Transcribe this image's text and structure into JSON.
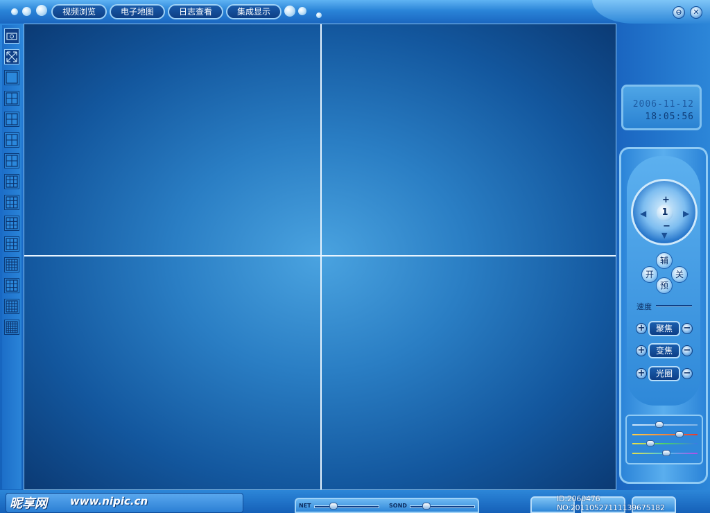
{
  "tabs": [
    {
      "label": "视频浏览"
    },
    {
      "label": "电子地图"
    },
    {
      "label": "日志查看"
    },
    {
      "label": "集成显示"
    }
  ],
  "window_buttons": {
    "minimize": "⊖",
    "close": "✕"
  },
  "clock": {
    "date": "2006-11-12",
    "time": "18:05:56"
  },
  "ptz": {
    "channel": "1",
    "zoom_in": "+",
    "zoom_out": "−",
    "aux_buttons": [
      {
        "label": "辅"
      },
      {
        "label": "开"
      },
      {
        "label": "关"
      },
      {
        "label": "预"
      }
    ],
    "speed_label": "速度",
    "controls": [
      {
        "label": "聚焦",
        "plus": "+",
        "minus": "−"
      },
      {
        "label": "变焦",
        "plus": "+",
        "minus": "−"
      },
      {
        "label": "光圈",
        "plus": "+",
        "minus": "−"
      }
    ]
  },
  "color_sliders": [
    {
      "level": 0.42
    },
    {
      "level": 0.72
    },
    {
      "level": 0.28
    },
    {
      "level": 0.52
    }
  ],
  "bottom": {
    "brand_cn": "昵享网",
    "brand_url": "www.nipic.cn",
    "net_label": "NET",
    "sond_label": "SOND",
    "net_level": 0.3,
    "sond_level": 0.25,
    "id_text": "ID:2060476 NO:20110527111139675182"
  },
  "layout_tools": [
    {
      "icon": "snapshot-icon"
    },
    {
      "icon": "fullscreen-icon"
    },
    {
      "icon": "layout-1-icon"
    },
    {
      "icon": "layout-4-icon"
    },
    {
      "icon": "layout-6-icon"
    },
    {
      "icon": "layout-7-icon"
    },
    {
      "icon": "layout-8-icon"
    },
    {
      "icon": "layout-9-icon"
    },
    {
      "icon": "layout-10-icon"
    },
    {
      "icon": "layout-12-icon"
    },
    {
      "icon": "layout-13-icon"
    },
    {
      "icon": "layout-16-icon"
    },
    {
      "icon": "layout-17-icon"
    },
    {
      "icon": "layout-25-icon"
    },
    {
      "icon": "layout-36-icon"
    }
  ],
  "colors": {
    "accent": "#2a84d8",
    "dark": "#0b3a74",
    "line": "#e9f5ff"
  }
}
